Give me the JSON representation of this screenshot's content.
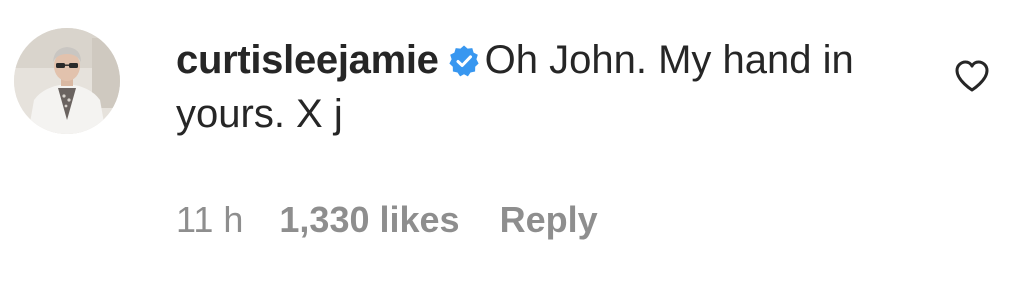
{
  "comment": {
    "username": "curtisleejamie",
    "verified": true,
    "text": "Oh John. My hand in yours. X j",
    "timestamp": "11 h",
    "likes": "1,330 likes",
    "reply_label": "Reply",
    "like_icon": "heart-outline-icon",
    "verified_icon": "verified-badge-icon",
    "colors": {
      "text": "#262626",
      "meta": "#8e8e8e",
      "verified_blue": "#3897f0"
    }
  }
}
